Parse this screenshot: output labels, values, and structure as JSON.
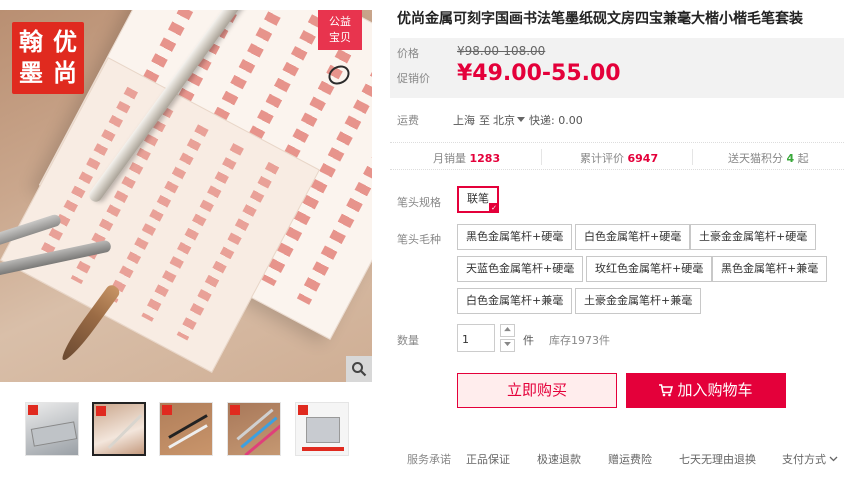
{
  "product": {
    "title": "优尚金属可刻字国画书法笔墨纸砚文房四宝兼毫大楷小楷毛笔套装",
    "logo_chars": [
      "翰",
      "优",
      "墨",
      "尚"
    ],
    "badge": [
      "公益",
      "宝贝"
    ]
  },
  "price": {
    "label": "价格",
    "original": "¥98.00-108.00",
    "promo_label": "促销价",
    "promo": "¥49.00-55.00"
  },
  "shipping": {
    "label": "运费",
    "from": "上海",
    "to_word": "至",
    "to": "北京",
    "express": "快递: 0.00"
  },
  "stats": {
    "monthly_sales_label": "月销量",
    "monthly_sales": "1283",
    "reviews_label": "累计评价",
    "reviews": "6947",
    "points_label": "送天猫积分",
    "points": "4",
    "points_suffix": "起"
  },
  "spec": {
    "label": "笔头规格",
    "options": [
      "联笔"
    ]
  },
  "hair": {
    "label": "笔头毛种",
    "options": [
      "黑色金属笔杆+硬毫",
      "白色金属笔杆+硬毫",
      "土豪金金属笔杆+硬毫",
      "天蓝色金属笔杆+硬毫",
      "玫红色金属笔杆+硬毫",
      "黑色金属笔杆+兼毫",
      "白色金属笔杆+兼毫",
      "土豪金金属笔杆+兼毫"
    ]
  },
  "quantity": {
    "label": "数量",
    "value": "1",
    "unit": "件",
    "stock": "库存1973件"
  },
  "actions": {
    "buy_now": "立即购买",
    "add_cart": "加入购物车"
  },
  "service": {
    "label": "服务承诺",
    "items": [
      "正品保证",
      "极速退款",
      "赠运费险",
      "七天无理由退换"
    ],
    "payment": "支付方式"
  },
  "colors": {
    "accent": "#e4003a",
    "logo_red": "#e02a1f"
  }
}
